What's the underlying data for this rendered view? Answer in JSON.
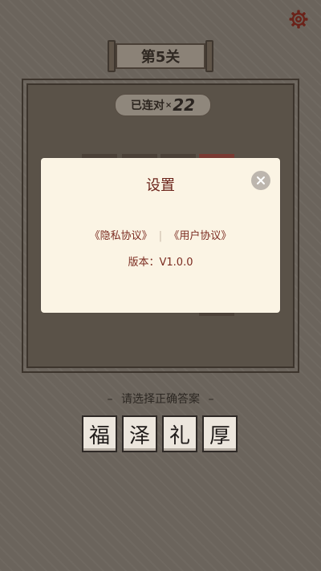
{
  "header": {
    "level_label": "第5关",
    "settings_icon": "gear-icon"
  },
  "board": {
    "streak_label": "已连对",
    "streak_x": "×",
    "streak_count": "22"
  },
  "dialog": {
    "title": "设置",
    "privacy_link": "《隐私协议》",
    "separator": "|",
    "user_link": "《用户协议》",
    "version": "版本：V1.0.0",
    "close_icon": "close-icon"
  },
  "prompt": {
    "text": "请选择正确答案",
    "dash": "–"
  },
  "answers": [
    "福",
    "泽",
    "礼",
    "厚"
  ],
  "colors": {
    "accent": "#7b2b20",
    "dialog_bg": "#fbf4e4",
    "background": "#6b645c"
  }
}
